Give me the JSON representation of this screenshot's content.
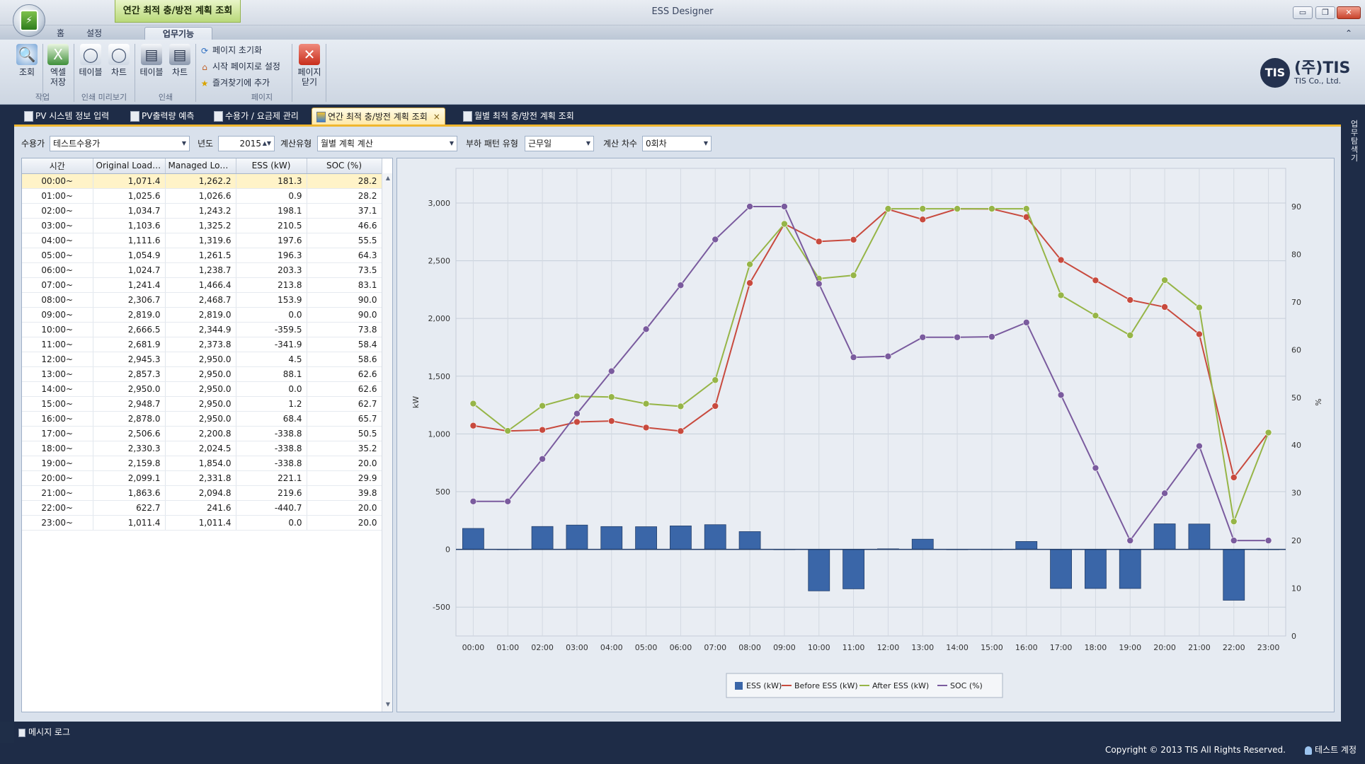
{
  "window": {
    "title": "ESS Designer",
    "context_tab": "연간 최적 충/방전 계획 조회",
    "min_label": "▭",
    "restore_label": "❐",
    "close_label": "✕",
    "ribbon_collapse_label": "⌃"
  },
  "ribbon": {
    "tabs": [
      "홈",
      "설정",
      "업무기능"
    ],
    "active_tab": "업무기능",
    "buttons": {
      "query": "조회",
      "excel_1": "엑셀",
      "excel_2": "저장",
      "preview_table": "테이블",
      "preview_chart": "차트",
      "print_table": "테이블",
      "print_chart": "차트",
      "close_page_1": "페이지",
      "close_page_2": "닫기"
    },
    "page_commands": [
      "페이지 초기화",
      "시작 페이지로 설정",
      "즐겨찾기에 추가"
    ],
    "groups": [
      "작업",
      "인쇄 미리보기",
      "인쇄",
      "페이지"
    ]
  },
  "logo": {
    "mark": "TIS",
    "name": "(주)TIS",
    "sub": "TIS Co., Ltd."
  },
  "doc_tabs": [
    "PV 시스템 정보 입력",
    "PV출력량 예측",
    "수용가 / 요금제 관리",
    "연간 최적 충/방전 계획 조회",
    "월별 최적 충/방전 계획 조회"
  ],
  "active_doc_tab": "연간 최적 충/방전 계획 조회",
  "tab_close": "×",
  "side_panel": "업무 탐색기",
  "filters": {
    "customer_label": "수용가",
    "customer_value": "테스트수용가",
    "year_label": "년도",
    "year_value": "2015",
    "calc_type_label": "계산유형",
    "calc_type_value": "월별 계획 계산",
    "pattern_label": "부하 패턴 유형",
    "pattern_value": "근무일",
    "round_label": "계산 차수",
    "round_value": "0회차"
  },
  "table": {
    "columns": [
      "시간",
      "Original Load (...",
      "Managed Load...",
      "ESS (kW)",
      "SOC (%)"
    ],
    "rows": [
      [
        "00:00~",
        "1,071.4",
        "1,262.2",
        "181.3",
        "28.2"
      ],
      [
        "01:00~",
        "1,025.6",
        "1,026.6",
        "0.9",
        "28.2"
      ],
      [
        "02:00~",
        "1,034.7",
        "1,243.2",
        "198.1",
        "37.1"
      ],
      [
        "03:00~",
        "1,103.6",
        "1,325.2",
        "210.5",
        "46.6"
      ],
      [
        "04:00~",
        "1,111.6",
        "1,319.6",
        "197.6",
        "55.5"
      ],
      [
        "05:00~",
        "1,054.9",
        "1,261.5",
        "196.3",
        "64.3"
      ],
      [
        "06:00~",
        "1,024.7",
        "1,238.7",
        "203.3",
        "73.5"
      ],
      [
        "07:00~",
        "1,241.4",
        "1,466.4",
        "213.8",
        "83.1"
      ],
      [
        "08:00~",
        "2,306.7",
        "2,468.7",
        "153.9",
        "90.0"
      ],
      [
        "09:00~",
        "2,819.0",
        "2,819.0",
        "0.0",
        "90.0"
      ],
      [
        "10:00~",
        "2,666.5",
        "2,344.9",
        "-359.5",
        "73.8"
      ],
      [
        "11:00~",
        "2,681.9",
        "2,373.8",
        "-341.9",
        "58.4"
      ],
      [
        "12:00~",
        "2,945.3",
        "2,950.0",
        "4.5",
        "58.6"
      ],
      [
        "13:00~",
        "2,857.3",
        "2,950.0",
        "88.1",
        "62.6"
      ],
      [
        "14:00~",
        "2,950.0",
        "2,950.0",
        "0.0",
        "62.6"
      ],
      [
        "15:00~",
        "2,948.7",
        "2,950.0",
        "1.2",
        "62.7"
      ],
      [
        "16:00~",
        "2,878.0",
        "2,950.0",
        "68.4",
        "65.7"
      ],
      [
        "17:00~",
        "2,506.6",
        "2,200.8",
        "-338.8",
        "50.5"
      ],
      [
        "18:00~",
        "2,330.3",
        "2,024.5",
        "-338.8",
        "35.2"
      ],
      [
        "19:00~",
        "2,159.8",
        "1,854.0",
        "-338.8",
        "20.0"
      ],
      [
        "20:00~",
        "2,099.1",
        "2,331.8",
        "221.1",
        "29.9"
      ],
      [
        "21:00~",
        "1,863.6",
        "2,094.8",
        "219.6",
        "39.8"
      ],
      [
        "22:00~",
        "622.7",
        "241.6",
        "-440.7",
        "20.0"
      ],
      [
        "23:00~",
        "1,011.4",
        "1,011.4",
        "0.0",
        "20.0"
      ]
    ]
  },
  "chart_data": {
    "type": "bar",
    "categories": [
      "00:00",
      "01:00",
      "02:00",
      "03:00",
      "04:00",
      "05:00",
      "06:00",
      "07:00",
      "08:00",
      "09:00",
      "10:00",
      "11:00",
      "12:00",
      "13:00",
      "14:00",
      "15:00",
      "16:00",
      "17:00",
      "18:00",
      "19:00",
      "20:00",
      "21:00",
      "22:00",
      "23:00"
    ],
    "series": [
      {
        "name": "ESS (kW)",
        "kind": "bar",
        "axis": "left",
        "color": "#3a66a8",
        "values": [
          181.3,
          0.9,
          198.1,
          210.5,
          197.6,
          196.3,
          203.3,
          213.8,
          153.9,
          0.0,
          -359.5,
          -341.9,
          4.5,
          88.1,
          0.0,
          1.2,
          68.4,
          -338.8,
          -338.8,
          -338.8,
          221.1,
          219.6,
          -440.7,
          0.0
        ]
      },
      {
        "name": "Before ESS (kW)",
        "kind": "line",
        "axis": "left",
        "color": "#c84a3e",
        "values": [
          1071.4,
          1025.6,
          1034.7,
          1103.6,
          1111.6,
          1054.9,
          1024.7,
          1241.4,
          2306.7,
          2819.0,
          2666.5,
          2681.9,
          2945.3,
          2857.3,
          2950.0,
          2948.7,
          2878.0,
          2506.6,
          2330.3,
          2159.8,
          2099.1,
          1863.6,
          622.7,
          1011.4
        ]
      },
      {
        "name": "After ESS (kW)",
        "kind": "line",
        "axis": "left",
        "color": "#96b547",
        "values": [
          1262.2,
          1026.6,
          1243.2,
          1325.2,
          1319.6,
          1261.5,
          1238.7,
          1466.4,
          2468.7,
          2819.0,
          2344.9,
          2373.8,
          2950.0,
          2950.0,
          2950.0,
          2950.0,
          2950.0,
          2200.8,
          2024.5,
          1854.0,
          2331.8,
          2094.8,
          241.6,
          1011.4
        ]
      },
      {
        "name": "SOC (%)",
        "kind": "line",
        "axis": "right",
        "color": "#7a5b9e",
        "values": [
          28.2,
          28.2,
          37.1,
          46.6,
          55.5,
          64.3,
          73.5,
          83.1,
          90.0,
          90.0,
          73.8,
          58.4,
          58.6,
          62.6,
          62.6,
          62.7,
          65.7,
          50.5,
          35.2,
          20.0,
          29.9,
          39.8,
          20.0,
          20.0
        ]
      }
    ],
    "ylabel": "kW",
    "y2label": "%",
    "ylim": [
      -750,
      3300
    ],
    "yticks": [
      3000,
      2500,
      2000,
      1500,
      1000,
      500,
      0,
      -500
    ],
    "ytick_labels": [
      "3,000",
      "2,500",
      "2,000",
      "1,500",
      "1,000",
      "500",
      "0",
      "-500"
    ],
    "y2lim": [
      0,
      98
    ],
    "y2ticks": [
      90,
      80,
      70,
      60,
      50,
      40,
      30,
      20,
      10,
      0
    ],
    "grid": true,
    "legend_position": "bottom"
  },
  "message_log": "메시지 로그",
  "copyright": "Copyright © 2013 TIS All Rights Reserved.",
  "user": "테스트 계정"
}
